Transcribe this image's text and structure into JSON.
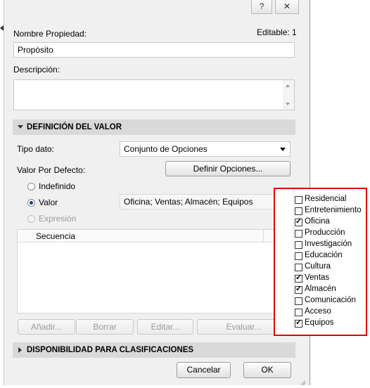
{
  "window": {
    "help_label": "?",
    "close_label": "✕"
  },
  "header": {
    "nombre_label": "Nombre Propiedad:",
    "editable_label": "Editable: 1",
    "nombre_value": "Propósito",
    "descripcion_label": "Descripción:",
    "descripcion_value": ""
  },
  "section_valor": {
    "title": "DEFINICIÓN DEL VALOR"
  },
  "tipo_dato": {
    "label": "Tipo dato:",
    "value": "Conjunto de Opciones"
  },
  "valor_defecto": {
    "label": "Valor Por Defecto:",
    "definir_button": "Definir Opciones..."
  },
  "radios": [
    {
      "label": "Indefinido",
      "selected": false,
      "enabled": true
    },
    {
      "label": "Valor",
      "selected": true,
      "enabled": true
    },
    {
      "label": "Expresión",
      "selected": false,
      "enabled": false
    }
  ],
  "valor_field": {
    "value": "Oficina; Ventas; Almacén; Equipos"
  },
  "table": {
    "header": "Secuencia"
  },
  "table_buttons": {
    "add": "Añadir...",
    "delete": "Borrar",
    "edit": "Editar...",
    "evaluate": "Evaluar..."
  },
  "section_disponibilidad": {
    "title": "DISPONIBILIDAD PARA CLASIFICACIONES"
  },
  "footer": {
    "cancel": "Cancelar",
    "ok": "OK"
  },
  "options_popup": {
    "items": [
      {
        "label": "Residencial",
        "checked": false
      },
      {
        "label": "Entretenimiento",
        "checked": false
      },
      {
        "label": "Oficina",
        "checked": true
      },
      {
        "label": "Producción",
        "checked": false
      },
      {
        "label": "Investigación",
        "checked": false
      },
      {
        "label": "Educación",
        "checked": false
      },
      {
        "label": "Cultura",
        "checked": false
      },
      {
        "label": "Ventas",
        "checked": true
      },
      {
        "label": "Almacén",
        "checked": true
      },
      {
        "label": "Comunicación",
        "checked": false
      },
      {
        "label": "Acceso",
        "checked": false
      },
      {
        "label": "Equipos",
        "checked": true
      }
    ]
  },
  "colors": {
    "highlight_border": "#e00000",
    "radio_selected": "#1a3c82"
  }
}
